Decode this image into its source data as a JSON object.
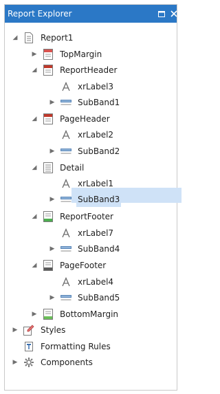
{
  "panel": {
    "title": "Report Explorer",
    "accent_color": "#2b78c6",
    "restore_icon": "restore-icon",
    "close_icon": "close-icon"
  },
  "tree": [
    {
      "label": "Report1",
      "icon": "report-icon",
      "expander": "expanded",
      "level": 0
    },
    {
      "label": "TopMargin",
      "icon": "topmargin-band-icon",
      "expander": "collapsed",
      "level": 1
    },
    {
      "label": "ReportHeader",
      "icon": "reportheader-band-icon",
      "expander": "expanded",
      "level": 1
    },
    {
      "label": "xrLabel3",
      "icon": "label-icon",
      "expander": "none",
      "level": 2
    },
    {
      "label": "SubBand1",
      "icon": "subband-icon",
      "expander": "collapsed",
      "level": 2
    },
    {
      "label": "PageHeader",
      "icon": "pageheader-band-icon",
      "expander": "expanded",
      "level": 1
    },
    {
      "label": "xrLabel2",
      "icon": "label-icon",
      "expander": "none",
      "level": 2
    },
    {
      "label": "SubBand2",
      "icon": "subband-icon",
      "expander": "collapsed",
      "level": 2
    },
    {
      "label": "Detail",
      "icon": "detail-band-icon",
      "expander": "expanded",
      "level": 1
    },
    {
      "label": "xrLabel1",
      "icon": "label-icon",
      "expander": "none",
      "level": 2
    },
    {
      "label": "SubBand3",
      "icon": "subband-icon",
      "expander": "collapsed",
      "level": 2,
      "selected": true
    },
    {
      "label": "ReportFooter",
      "icon": "reportfooter-band-icon",
      "expander": "expanded",
      "level": 1
    },
    {
      "label": "xrLabel7",
      "icon": "label-icon",
      "expander": "none",
      "level": 2
    },
    {
      "label": "SubBand4",
      "icon": "subband-icon",
      "expander": "collapsed",
      "level": 2
    },
    {
      "label": "PageFooter",
      "icon": "pagefooter-band-icon",
      "expander": "expanded",
      "level": 1
    },
    {
      "label": "xrLabel4",
      "icon": "label-icon",
      "expander": "none",
      "level": 2
    },
    {
      "label": "SubBand5",
      "icon": "subband-icon",
      "expander": "collapsed",
      "level": 2
    },
    {
      "label": "BottomMargin",
      "icon": "bottommargin-band-icon",
      "expander": "collapsed",
      "level": 1
    },
    {
      "label": "Styles",
      "icon": "styles-icon",
      "expander": "collapsed",
      "level": 0
    },
    {
      "label": "Formatting Rules",
      "icon": "formatting-rules-icon",
      "expander": "none",
      "level": 0
    },
    {
      "label": "Components",
      "icon": "components-icon",
      "expander": "collapsed",
      "level": 0
    }
  ]
}
